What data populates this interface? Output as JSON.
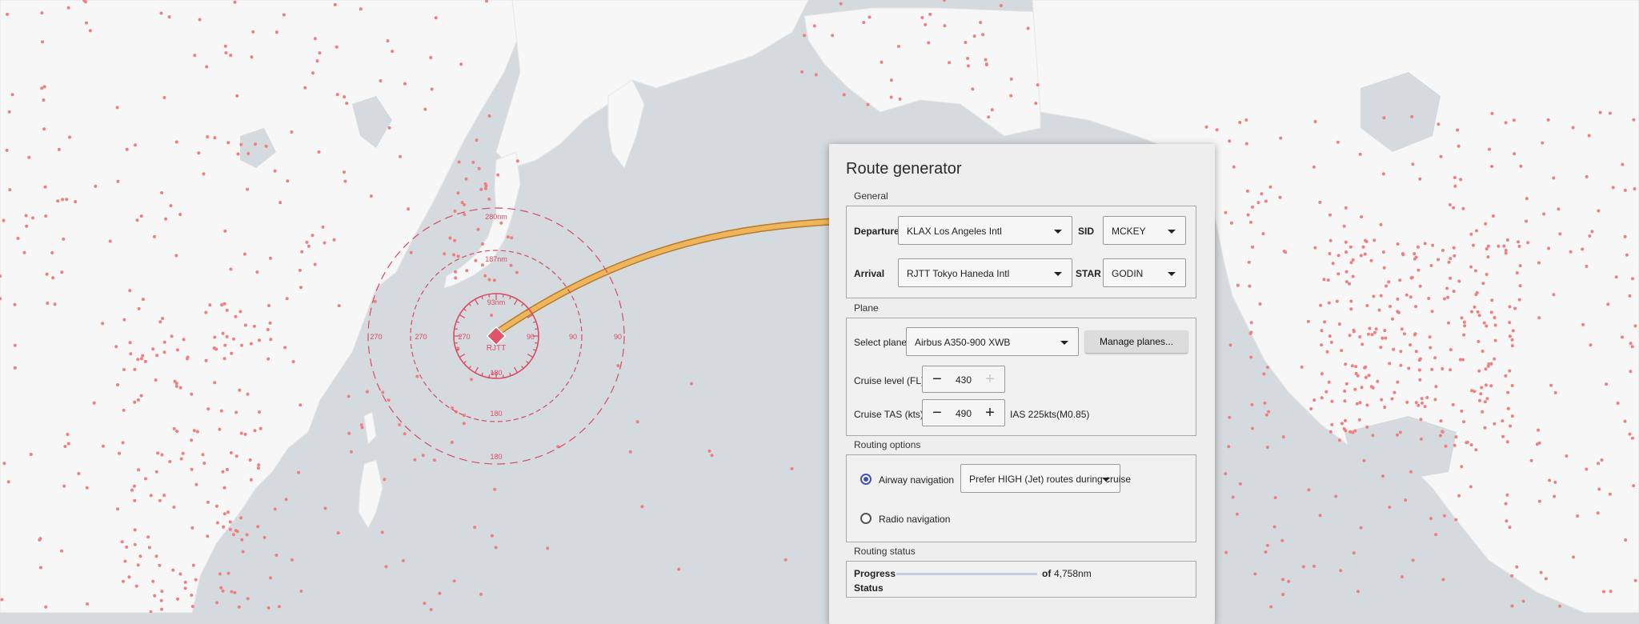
{
  "map": {
    "colors": {
      "water": "#d5dade",
      "land": "#f7f7f7",
      "airport": "#f08080",
      "route": "#e8a84a",
      "rose": "#d94a62"
    },
    "rose": {
      "airport_label": "RJTT",
      "ring_labels": [
        "280nm",
        "187nm",
        "93nm"
      ],
      "bearing_labels": [
        "270",
        "90",
        "180"
      ]
    }
  },
  "panel": {
    "title": "Route generator",
    "general": {
      "section_label": "General",
      "departure_label": "Departure",
      "departure_value": "KLAX Los Angeles Intl",
      "sid_label": "SID",
      "sid_value": "MCKEY",
      "arrival_label": "Arrival",
      "arrival_value": "RJTT Tokyo Haneda Intl",
      "star_label": "STAR",
      "star_value": "GODIN"
    },
    "plane": {
      "section_label": "Plane",
      "select_label": "Select plane",
      "plane_value": "Airbus A350-900 XWB",
      "manage_button": "Manage planes...",
      "cruise_level_label": "Cruise level (FL)",
      "cruise_level_value": "430",
      "cruise_tas_label": "Cruise TAS (kts)",
      "cruise_tas_value": "490",
      "ias_text": "IAS 225kts(M0.85)",
      "minus_glyph": "−",
      "plus_glyph": "+"
    },
    "routing_options": {
      "section_label": "Routing options",
      "airway_label": "Airway navigation",
      "airway_selected": true,
      "airway_preference": "Prefer HIGH (Jet) routes during cruise",
      "radio_label": "Radio navigation"
    },
    "routing_status": {
      "section_label": "Routing status",
      "progress_label": "Progress",
      "progress_fraction": 0.0,
      "of_label": "of",
      "distance": "4,758nm",
      "status_label": "Status"
    }
  }
}
